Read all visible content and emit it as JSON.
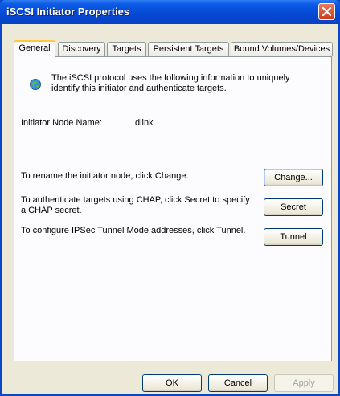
{
  "window": {
    "title": "iSCSI Initiator Properties"
  },
  "tabs": [
    {
      "label": "General",
      "active": true
    },
    {
      "label": "Discovery",
      "active": false
    },
    {
      "label": "Targets",
      "active": false
    },
    {
      "label": "Persistent Targets",
      "active": false
    },
    {
      "label": "Bound Volumes/Devices",
      "active": false
    }
  ],
  "general": {
    "description": "The iSCSI protocol uses the following information to uniquely identify this initiator and authenticate targets.",
    "node_label": "Initiator Node Name:",
    "node_value": "dlink",
    "rename_text": "To rename the initiator node, click Change.",
    "chap_text": "To authenticate targets using CHAP, click Secret to specify a CHAP secret.",
    "ipsec_text": "To configure IPSec Tunnel Mode addresses, click Tunnel.",
    "change_label": "Change...",
    "secret_label": "Secret",
    "tunnel_label": "Tunnel"
  },
  "footer": {
    "ok_label": "OK",
    "cancel_label": "Cancel",
    "apply_label": "Apply"
  },
  "icons": {
    "info": "globe-info-icon",
    "close": "close-icon"
  }
}
